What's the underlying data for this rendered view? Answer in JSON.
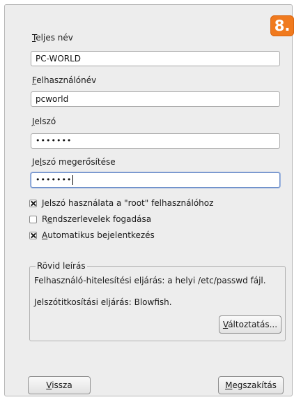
{
  "step_badge": "8.",
  "full_name": {
    "label_accel": "T",
    "label_rest": "eljes név",
    "value": "PC-WORLD"
  },
  "username": {
    "label_accel": "F",
    "label_rest": "elhasználónév",
    "value": "pcworld"
  },
  "password": {
    "label_accel": "J",
    "label_rest": "elszó",
    "value": "•••••••"
  },
  "password_confirm": {
    "label_pre": "Je",
    "label_accel": "l",
    "label_rest": "szó megerősítése",
    "value": "•••••••"
  },
  "options": [
    {
      "pre": "",
      "accel": "",
      "rest": "Jelszó használata a \"root\" felhasználóhoz",
      "checked": true
    },
    {
      "pre": "R",
      "accel": "e",
      "rest": "ndszerlevelek fogadása",
      "checked": false
    },
    {
      "pre": "",
      "accel": "A",
      "rest": "utomatikus bejelentkezés",
      "checked": true
    }
  ],
  "summary": {
    "title": "Rövid leírás",
    "auth_line": "Felhasználó-hitelesítési eljárás: a helyi /etc/passwd fájl.",
    "encryption_line": "Jelszótitkosítási eljárás: Blowfish.",
    "change_accel": "V",
    "change_rest": "áltoztatás..."
  },
  "buttons": {
    "back_accel": "V",
    "back_rest": "issza",
    "cancel_accel": "M",
    "cancel_rest": "egszakítás"
  }
}
